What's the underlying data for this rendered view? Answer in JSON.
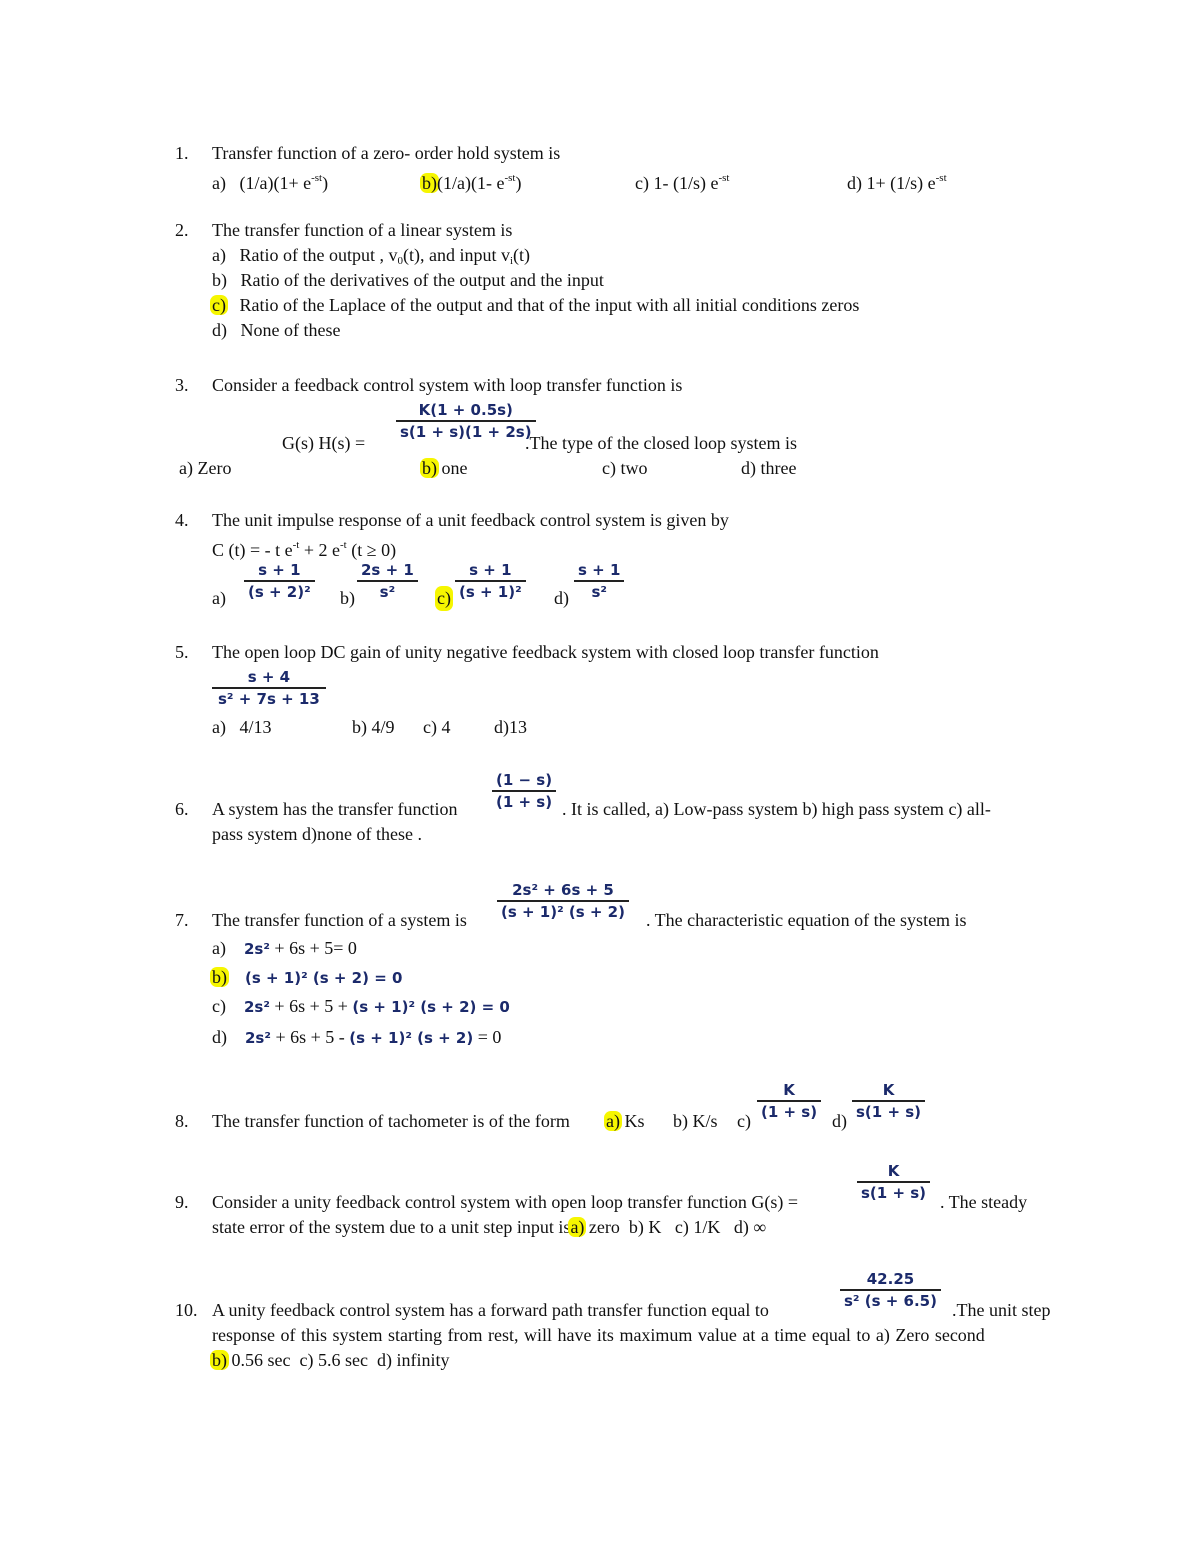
{
  "highlight_color": "#f6f600",
  "questions": [
    {
      "num": "1.",
      "text": "Transfer function of a zero- order hold system is",
      "options": {
        "a": {
          "label": "a)",
          "text": "(1/a)(1+ e",
          "sup": "-st",
          "close": ")"
        },
        "b": {
          "label": "b)",
          "text": "(1/a)(1- e",
          "sup": "-st",
          "close": ")"
        },
        "c": {
          "label": "c)",
          "text": "1- (1/s) e",
          "sup": "-st"
        },
        "d": {
          "label": "d)",
          "text": "1+ (1/s) e",
          "sup": "-st"
        }
      },
      "answer": "b"
    },
    {
      "num": "2.",
      "text": "The transfer function of a linear system is",
      "options": {
        "a": {
          "label": "a)",
          "text1": "Ratio of the output , v",
          "sub1": "0",
          "text2": "(t), and input v",
          "sub2": "i",
          "text3": "(t)"
        },
        "b": {
          "label": "b)",
          "text": "Ratio of the derivatives of the output and the input"
        },
        "c": {
          "label": "c)",
          "text": "Ratio of the Laplace of the output and that of the input with all initial conditions zeros"
        },
        "d": {
          "label": "d)",
          "text": "None of these"
        }
      },
      "answer": "c"
    },
    {
      "num": "3.",
      "text": "Consider a feedback control  system with loop transfer function is",
      "lhs": "G(s) H(s) =",
      "frac": {
        "num": "K(1 + 0.5s)",
        "den": "s(1 + s)(1 + 2s)"
      },
      "after": ".The type of the closed loop system is",
      "options": {
        "a": {
          "label": "a)",
          "text": "Zero"
        },
        "b": {
          "label": "b)",
          "text": "one"
        },
        "c": {
          "label": "c)",
          "text": "two"
        },
        "d": {
          "label": "d)",
          "text": "three"
        }
      },
      "answer": "b"
    },
    {
      "num": "4.",
      "text": "The unit impulse response of a unit feedback control system is given by",
      "eq": {
        "p1": "C (t) = - t e",
        "s1": "-t",
        "p2": " + 2 e",
        "s2": "-t",
        "p3": " (t ≥ 0)"
      },
      "options": {
        "a": {
          "label": "a)",
          "num": "s + 1",
          "den": "(s + 2)²"
        },
        "b": {
          "label": "b)",
          "num": "2s + 1",
          "den": "s²"
        },
        "c": {
          "label": "c)",
          "num": "s + 1",
          "den": "(s + 1)²"
        },
        "d": {
          "label": "d)",
          "num": "s + 1",
          "den": "s²"
        }
      },
      "answer": "c"
    },
    {
      "num": "5.",
      "text": "The open loop DC gain of unity negative feedback system with closed loop transfer function",
      "frac": {
        "num": "s + 4",
        "den": "s²  + 7s + 13"
      },
      "options": {
        "a": {
          "label": "a)",
          "text": "4/13"
        },
        "b": {
          "label": "b)",
          "text": "4/9"
        },
        "c": {
          "label": "c)",
          "text": "4"
        },
        "d": {
          "label": "d)",
          "text": "13"
        }
      }
    },
    {
      "num": "6.",
      "text": "A system has the transfer function",
      "frac": {
        "num": "(1 − s)",
        "den": "(1 + s)"
      },
      "after": ". It is called, a) Low-pass system b) high pass system c) all-",
      "line2": "pass system  d)none of these ."
    },
    {
      "num": "7.",
      "text": "The transfer function of a system is",
      "frac": {
        "num": "2s²  + 6s + 5",
        "den": "(s + 1)² (s + 2)"
      },
      "after": ". The characteristic equation of the system is",
      "options": {
        "a": {
          "label": "a)",
          "m1": "2s²",
          "t1": " + 6s + 5= 0"
        },
        "b": {
          "label": "b)",
          "m1": "(s + 1)²  (s + 2) = 0"
        },
        "c": {
          "label": "c)",
          "m1": "2s²",
          "t1": " + 6s + 5 + ",
          "m2": "(s + 1)²  (s + 2) = 0"
        },
        "d": {
          "label": "d)",
          "m1": "2s²",
          "t1": " + 6s + 5 - ",
          "m2": "(s + 1)²  (s + 2)",
          "t2": " = 0"
        }
      },
      "answer": "b"
    },
    {
      "num": "8.",
      "text": "The transfer function of tachometer is of the form",
      "options": {
        "a": {
          "label": "a)",
          "text": "Ks"
        },
        "b": {
          "label": "b)",
          "text": "K/s"
        },
        "c": {
          "label": "c)",
          "num": "K",
          "den": "(1 + s)"
        },
        "d": {
          "label": "d)",
          "num": "K",
          "den": "s(1 + s)"
        }
      },
      "answer": "a"
    },
    {
      "num": "9.",
      "text": "Consider a unity feedback control system with open loop transfer function G(s) =",
      "frac": {
        "num": "K",
        "den": "s(1 + s)"
      },
      "after": ". The steady",
      "line2": "state error of the system due to a unit step input is",
      "options": {
        "a": {
          "label": "a)",
          "text": "zero"
        },
        "b": {
          "label": "b)",
          "text": "K"
        },
        "c": {
          "label": "c)",
          "text": "1/K"
        },
        "d": {
          "label": "d)",
          "text": "∞"
        }
      },
      "answer": "a"
    },
    {
      "num": "10.",
      "text": "A unity feedback control system has a forward path transfer function equal to",
      "frac": {
        "num": "42.25",
        "den": "s² (s + 6.5)"
      },
      "after": ".The unit step",
      "line2": "response of this system starting from rest, will have its maximum value at a time equal to  a)  Zero   second",
      "options": {
        "b": {
          "label": "b)",
          "text": "0.56 sec"
        },
        "c": {
          "label": "c)",
          "text": "5.6 sec"
        },
        "d": {
          "label": "d)",
          "text": "infinity"
        }
      },
      "answer": "b"
    }
  ]
}
